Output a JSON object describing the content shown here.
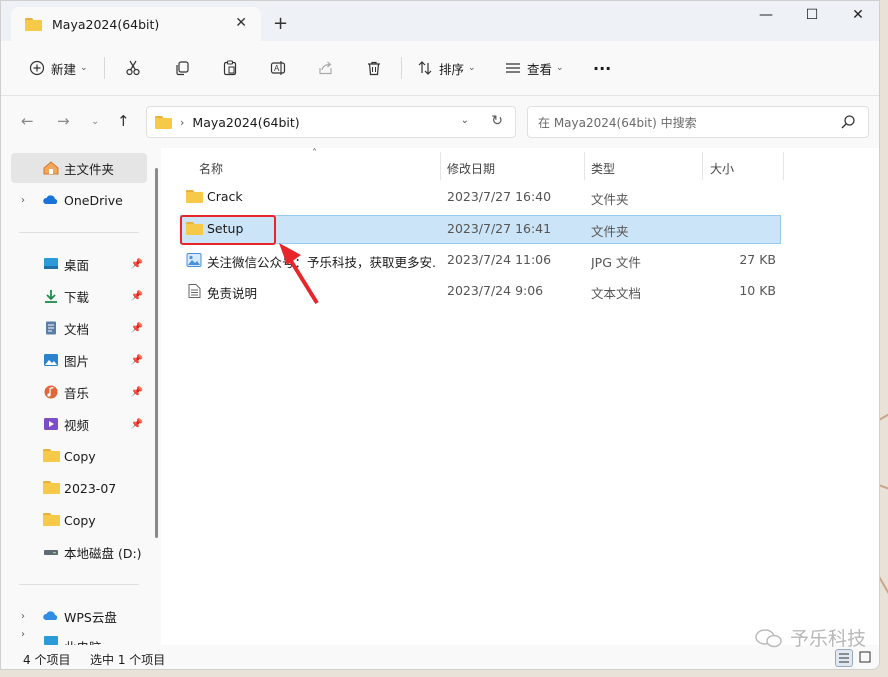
{
  "window": {
    "tab_title": "Maya2024(64bit)",
    "tab_close": "✕",
    "new_tab": "+",
    "minimize": "—",
    "maximize": "☐",
    "close": "✕"
  },
  "toolbar": {
    "new_label": "新建",
    "sort_label": "排序",
    "view_label": "查看",
    "more": "···"
  },
  "address": {
    "crumb": "Maya2024(64bit)",
    "search_placeholder": "在 Maya2024(64bit) 中搜索"
  },
  "sidebar": {
    "items": [
      {
        "label": "主文件夹",
        "icon": "home-icon"
      },
      {
        "label": "OneDrive",
        "icon": "onedrive-icon"
      },
      {
        "label": "桌面",
        "icon": "desktop-icon"
      },
      {
        "label": "下载",
        "icon": "download-icon"
      },
      {
        "label": "文档",
        "icon": "document-icon"
      },
      {
        "label": "图片",
        "icon": "picture-icon"
      },
      {
        "label": "音乐",
        "icon": "music-icon"
      },
      {
        "label": "视频",
        "icon": "video-icon"
      },
      {
        "label": "Copy",
        "icon": "folder-icon"
      },
      {
        "label": "2023-07",
        "icon": "folder-icon"
      },
      {
        "label": "Copy",
        "icon": "folder-icon"
      },
      {
        "label": "本地磁盘 (D:)",
        "icon": "drive-icon"
      },
      {
        "label": "WPS云盘",
        "icon": "cloud-icon"
      },
      {
        "label": "此电脑",
        "icon": "computer-icon"
      }
    ]
  },
  "columns": {
    "name": "名称",
    "date": "修改日期",
    "type": "类型",
    "size": "大小"
  },
  "files": [
    {
      "name": "Crack",
      "date": "2023/7/27 16:40",
      "type": "文件夹",
      "size": "",
      "icon": "folder-icon"
    },
    {
      "name": "Setup",
      "date": "2023/7/27 16:41",
      "type": "文件夹",
      "size": "",
      "icon": "folder-icon"
    },
    {
      "name": "关注微信公众号：予乐科技，获取更多安...",
      "date": "2023/7/24 11:06",
      "type": "JPG 文件",
      "size": "27 KB",
      "icon": "image-file-icon"
    },
    {
      "name": "免责说明",
      "date": "2023/7/24 9:06",
      "type": "文本文档",
      "size": "10 KB",
      "icon": "text-file-icon"
    }
  ],
  "status": {
    "count": "4 个项目",
    "selected": "选中 1 个项目"
  },
  "watermark": "予乐科技",
  "colors": {
    "selection": "#cce4f7",
    "highlight": "#e8262a",
    "folder": "#f7c948"
  }
}
